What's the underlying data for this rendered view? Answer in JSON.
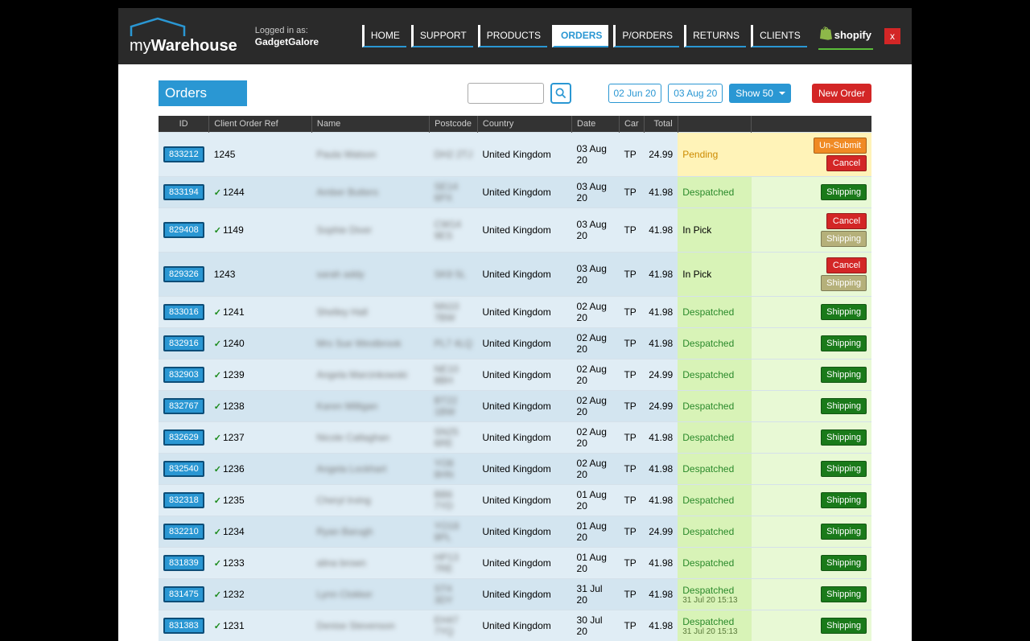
{
  "header": {
    "logo_left": "my",
    "logo_right": "Warehouse",
    "logged_in_label": "Logged in as:",
    "user": "GadgetGalore",
    "nav": [
      "HOME",
      "SUPPORT",
      "PRODUCTS",
      "ORDERS",
      "P/ORDERS",
      "RETURNS",
      "CLIENTS"
    ],
    "shopify": "shopify",
    "close": "x"
  },
  "controls": {
    "tab": "Orders",
    "date_from": "02 Jun 20",
    "date_to": "03 Aug 20",
    "show": "Show 50",
    "new_order": "New Order",
    "search_placeholder": ""
  },
  "columns": [
    "ID",
    "Client Order Ref",
    "Name",
    "Postcode",
    "Country",
    "Date",
    "Car",
    "Total",
    "",
    ""
  ],
  "buttons": {
    "unsubmit": "Un-Submit",
    "cancel": "Cancel",
    "shipping": "Shipping"
  },
  "rows": [
    {
      "id": "833212",
      "chk": false,
      "ref": "1245",
      "name": "Paula Watson",
      "pc": "DH2 2TJ",
      "country": "United Kingdom",
      "date": "03 Aug 20",
      "car": "TP",
      "total": "24.99",
      "status": "Pending",
      "status_sub": "",
      "actions": [
        "unsubmit",
        "cancel"
      ],
      "pend": true
    },
    {
      "id": "833194",
      "chk": true,
      "ref": "1244",
      "name": "Amber Butters",
      "pc": "SE14 6PX",
      "country": "United Kingdom",
      "date": "03 Aug 20",
      "car": "TP",
      "total": "41.98",
      "status": "Despatched",
      "status_sub": "",
      "actions": [
        "shipping"
      ],
      "pend": false
    },
    {
      "id": "829408",
      "chk": true,
      "ref": "1149",
      "name": "Sophie Diver",
      "pc": "CW14 9ES",
      "country": "United Kingdom",
      "date": "03 Aug 20",
      "car": "TP",
      "total": "41.98",
      "status": "In Pick",
      "status_sub": "",
      "actions": [
        "cancel",
        "shipd"
      ],
      "pend": false
    },
    {
      "id": "829326",
      "chk": false,
      "ref": "1243",
      "name": "sarah addy",
      "pc": "SK8 5L",
      "country": "United Kingdom",
      "date": "03 Aug 20",
      "car": "TP",
      "total": "41.98",
      "status": "In Pick",
      "status_sub": "",
      "actions": [
        "cancel",
        "shipd"
      ],
      "pend": false
    },
    {
      "id": "833016",
      "chk": true,
      "ref": "1241",
      "name": "Shelley Hall",
      "pc": "NN10 7BW",
      "country": "United Kingdom",
      "date": "02 Aug 20",
      "car": "TP",
      "total": "41.98",
      "status": "Despatched",
      "status_sub": "",
      "actions": [
        "shipping"
      ],
      "pend": false
    },
    {
      "id": "832916",
      "chk": true,
      "ref": "1240",
      "name": "Mrs Sue Westbrook",
      "pc": "PL7 4LQ",
      "country": "United Kingdom",
      "date": "02 Aug 20",
      "car": "TP",
      "total": "41.98",
      "status": "Despatched",
      "status_sub": "",
      "actions": [
        "shipping"
      ],
      "pend": false
    },
    {
      "id": "832903",
      "chk": true,
      "ref": "1239",
      "name": "Angela Marcinkowski",
      "pc": "NE10 8BH",
      "country": "United Kingdom",
      "date": "02 Aug 20",
      "car": "TP",
      "total": "24.99",
      "status": "Despatched",
      "status_sub": "",
      "actions": [
        "shipping"
      ],
      "pend": false
    },
    {
      "id": "832767",
      "chk": true,
      "ref": "1238",
      "name": "Karen Milligan",
      "pc": "BT22 1BW",
      "country": "United Kingdom",
      "date": "02 Aug 20",
      "car": "TP",
      "total": "24.99",
      "status": "Despatched",
      "status_sub": "",
      "actions": [
        "shipping"
      ],
      "pend": false
    },
    {
      "id": "832629",
      "chk": true,
      "ref": "1237",
      "name": "Nicole Callaghan",
      "pc": "SN25 6RE",
      "country": "United Kingdom",
      "date": "02 Aug 20",
      "car": "TP",
      "total": "41.98",
      "status": "Despatched",
      "status_sub": "",
      "actions": [
        "shipping"
      ],
      "pend": false
    },
    {
      "id": "832540",
      "chk": true,
      "ref": "1236",
      "name": "Angela Lockhart",
      "pc": "YO8 8HN",
      "country": "United Kingdom",
      "date": "02 Aug 20",
      "car": "TP",
      "total": "41.98",
      "status": "Despatched",
      "status_sub": "",
      "actions": [
        "shipping"
      ],
      "pend": false
    },
    {
      "id": "832318",
      "chk": true,
      "ref": "1235",
      "name": "Cheryl Irving",
      "pc": "BB6 7YD",
      "country": "United Kingdom",
      "date": "01 Aug 20",
      "car": "TP",
      "total": "41.98",
      "status": "Despatched",
      "status_sub": "",
      "actions": [
        "shipping"
      ],
      "pend": false
    },
    {
      "id": "832210",
      "chk": true,
      "ref": "1234",
      "name": "Ryan Barugh",
      "pc": "YO18 8PL",
      "country": "United Kingdom",
      "date": "01 Aug 20",
      "car": "TP",
      "total": "24.99",
      "status": "Despatched",
      "status_sub": "",
      "actions": [
        "shipping"
      ],
      "pend": false
    },
    {
      "id": "831839",
      "chk": true,
      "ref": "1233",
      "name": "alina brown",
      "pc": "HP13 7RE",
      "country": "United Kingdom",
      "date": "01 Aug 20",
      "car": "TP",
      "total": "41.98",
      "status": "Despatched",
      "status_sub": "",
      "actions": [
        "shipping"
      ],
      "pend": false
    },
    {
      "id": "831475",
      "chk": true,
      "ref": "1232",
      "name": "Lynn Clokker",
      "pc": "ST4 3DY",
      "country": "United Kingdom",
      "date": "31 Jul 20",
      "car": "TP",
      "total": "41.98",
      "status": "Despatched",
      "status_sub": "31 Jul 20 15:13",
      "actions": [
        "shipping"
      ],
      "pend": false
    },
    {
      "id": "831383",
      "chk": true,
      "ref": "1231",
      "name": "Denise Stevenson",
      "pc": "EH47 7YQ",
      "country": "United Kingdom",
      "date": "30 Jul 20",
      "car": "TP",
      "total": "41.98",
      "status": "Despatched",
      "status_sub": "31 Jul 20 15:13",
      "actions": [
        "shipping"
      ],
      "pend": false
    }
  ]
}
